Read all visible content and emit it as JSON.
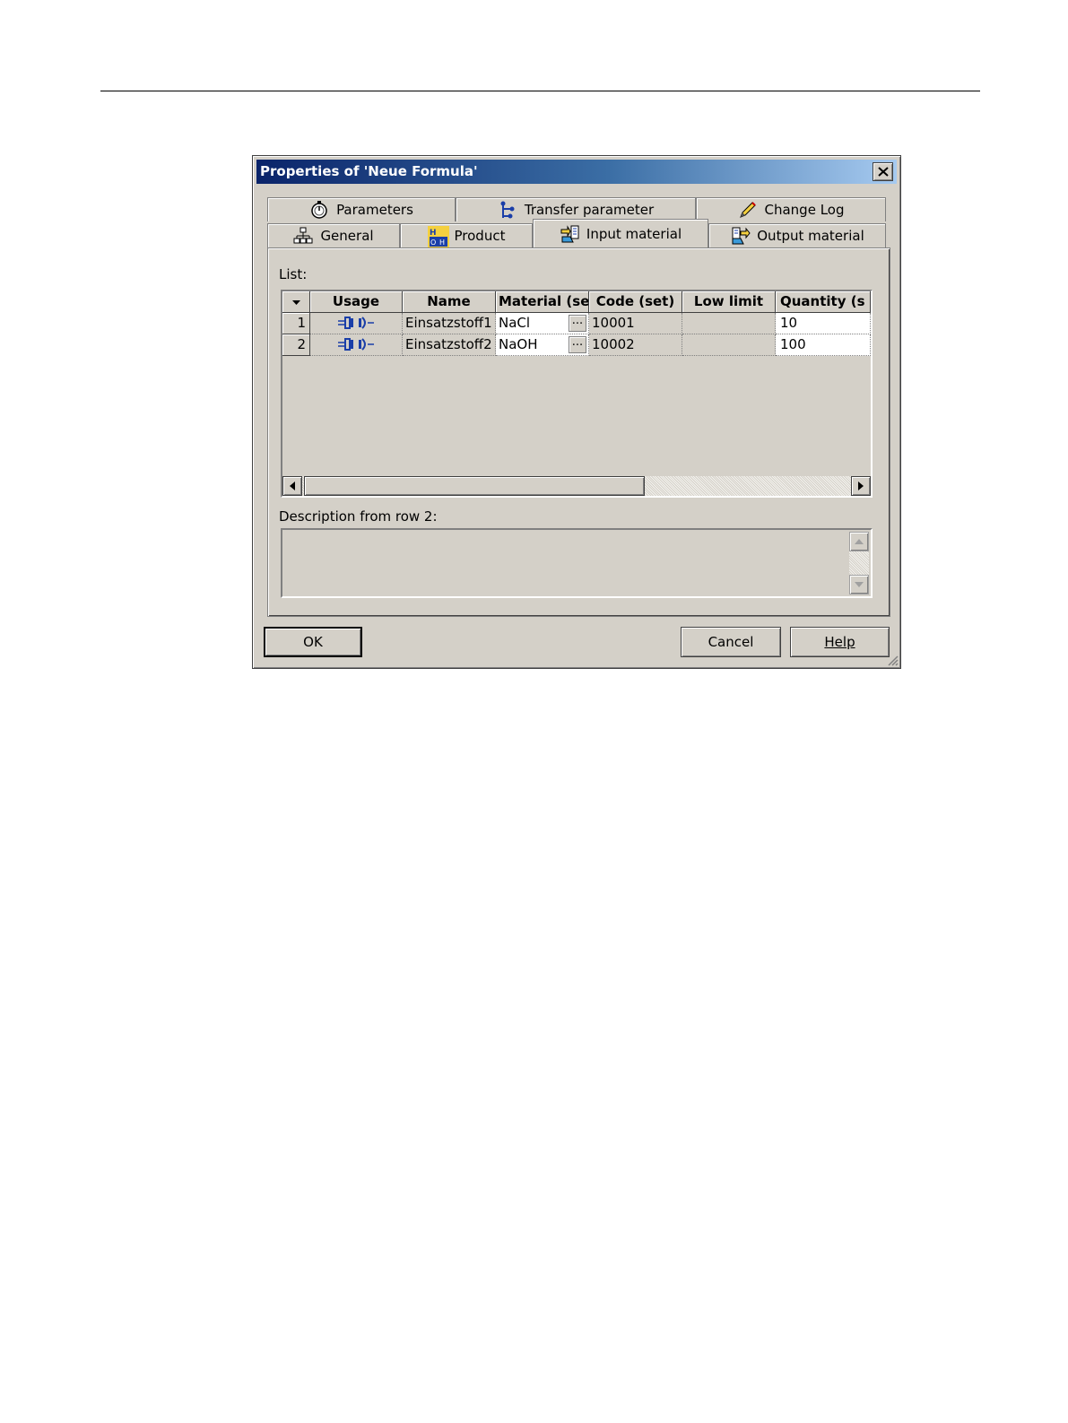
{
  "dialog": {
    "title": "Properties of 'Neue Formula'"
  },
  "tabs_row1": [
    {
      "label": "Parameters",
      "icon": "stopwatch-icon"
    },
    {
      "label": "Transfer parameter",
      "icon": "transfer-tree-icon"
    },
    {
      "label": "Change Log",
      "icon": "pencil-icon"
    }
  ],
  "tabs_row2": [
    {
      "label": "General",
      "icon": "hierarchy-icon"
    },
    {
      "label": "Product",
      "icon": "product-chemical-icon"
    },
    {
      "label": "Input material",
      "icon": "input-material-icon",
      "active": true
    },
    {
      "label": "Output material",
      "icon": "output-material-icon"
    }
  ],
  "list": {
    "label": "List:",
    "columns": [
      "Usage",
      "Name",
      "Material (se",
      "Code (set)",
      "Low limit",
      "Quantity (s"
    ],
    "rows": [
      {
        "num": "1",
        "usage_icon": "usage-connector-icon",
        "name": "Einsatzstoff1",
        "material": "NaCl",
        "material_button": "...",
        "code": "10001",
        "low_limit": "",
        "quantity": "10"
      },
      {
        "num": "2",
        "usage_icon": "usage-connector-icon",
        "name": "Einsatzstoff2",
        "material": "NaOH",
        "material_button": "...",
        "code": "10002",
        "low_limit": "",
        "quantity": "100"
      }
    ]
  },
  "description": {
    "label": "Description from row 2:",
    "value": ""
  },
  "buttons": {
    "ok": "OK",
    "cancel": "Cancel",
    "help": "Help"
  }
}
